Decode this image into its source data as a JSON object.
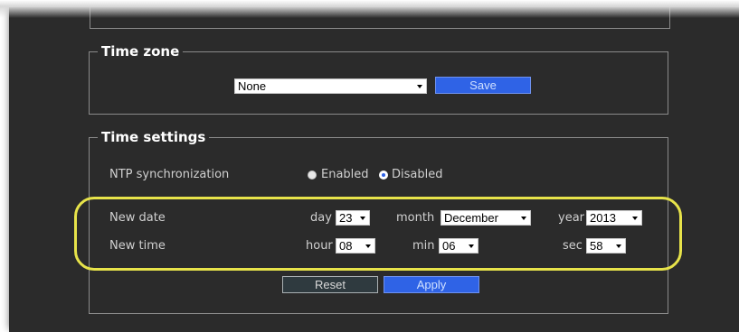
{
  "colors": {
    "panel_bg": "#2b2b2b",
    "accent_blue": "#2f63e6",
    "highlight_ring": "#e7e34a"
  },
  "timezone": {
    "legend": "Time zone",
    "select_value": "None",
    "save_label": "Save"
  },
  "timesettings": {
    "legend": "Time settings",
    "ntp": {
      "label": "NTP synchronization",
      "enabled_label": "Enabled",
      "disabled_label": "Disabled",
      "selected": "Disabled"
    },
    "date": {
      "label": "New date",
      "day_label": "day",
      "day_value": "23",
      "month_label": "month",
      "month_value": "December",
      "year_label": "year",
      "year_value": "2013"
    },
    "time": {
      "label": "New time",
      "hour_label": "hour",
      "hour_value": "08",
      "min_label": "min",
      "min_value": "06",
      "sec_label": "sec",
      "sec_value": "58"
    },
    "reset_label": "Reset",
    "apply_label": "Apply"
  }
}
